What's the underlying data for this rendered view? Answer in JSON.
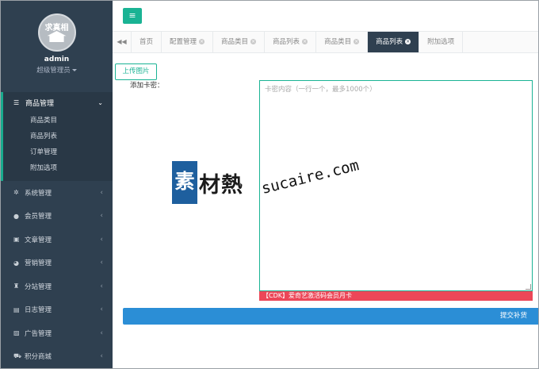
{
  "profile": {
    "avatar_text": "求真相",
    "name": "admin",
    "role": "超级管理员"
  },
  "menu": {
    "active": {
      "label": "商品管理",
      "icon": "list-icon",
      "items": [
        "商品类目",
        "商品列表",
        "订单管理",
        "附加选项"
      ]
    },
    "items": [
      {
        "label": "系统管理",
        "icon": "gear-icon"
      },
      {
        "label": "会员管理",
        "icon": "users-icon"
      },
      {
        "label": "文章管理",
        "icon": "copy-icon"
      },
      {
        "label": "营销管理",
        "icon": "pie-chart-icon"
      },
      {
        "label": "分站管理",
        "icon": "sitemap-icon"
      },
      {
        "label": "日志管理",
        "icon": "log-icon"
      },
      {
        "label": "广告管理",
        "icon": "image-icon"
      },
      {
        "label": "积分商城",
        "icon": "cart-icon"
      }
    ]
  },
  "topbar": {
    "toggle_icon": "menu-icon"
  },
  "tabs": [
    {
      "label": "首页",
      "closable": false,
      "active": false
    },
    {
      "label": "配置管理",
      "closable": true,
      "active": false
    },
    {
      "label": "商品类目",
      "closable": true,
      "active": false
    },
    {
      "label": "商品列表",
      "closable": true,
      "active": false
    },
    {
      "label": "商品类目",
      "closable": true,
      "active": false
    },
    {
      "label": "商品列表",
      "closable": true,
      "active": true
    },
    {
      "label": "附加选项",
      "closable": false,
      "active": false
    }
  ],
  "content": {
    "upload_label": "上传图片",
    "field_label": "添加卡密：",
    "textarea_placeholder": "卡密内容（一行一个，最多1000个）",
    "product_name": "【CDK】爱奇艺激活码会员月卡",
    "submit_label": "提交补货"
  },
  "watermark": {
    "box_char": "素",
    "text": "材熱",
    "url": "sucaire.com"
  },
  "colors": {
    "sidebar_bg": "#2f4050",
    "accent": "#1ab394",
    "danger": "#ec4758",
    "primary": "#2b8ed6"
  }
}
